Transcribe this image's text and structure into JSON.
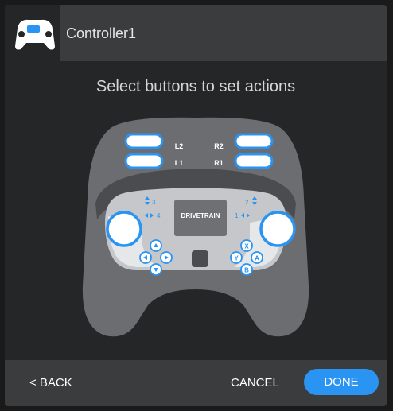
{
  "header": {
    "title": "Controller1",
    "icon": "gamepad-icon"
  },
  "instruction": "Select buttons to set actions",
  "controller": {
    "shoulder": {
      "l2": "L2",
      "l1": "L1",
      "r2": "R2",
      "r1": "R1"
    },
    "screen_label": "DRIVETRAIN",
    "left_axes": {
      "top": "3",
      "bottom": "4"
    },
    "right_axes": {
      "top": "2",
      "bottom": "1"
    },
    "face_buttons": {
      "x": "X",
      "y": "Y",
      "a": "A",
      "b": "B"
    },
    "highlight_color": "#2a94f2"
  },
  "footer": {
    "back": "< BACK",
    "cancel": "CANCEL",
    "done": "DONE"
  },
  "colors": {
    "accent": "#2a94f2",
    "panel": "#252627",
    "header": "#3b3c3e"
  }
}
